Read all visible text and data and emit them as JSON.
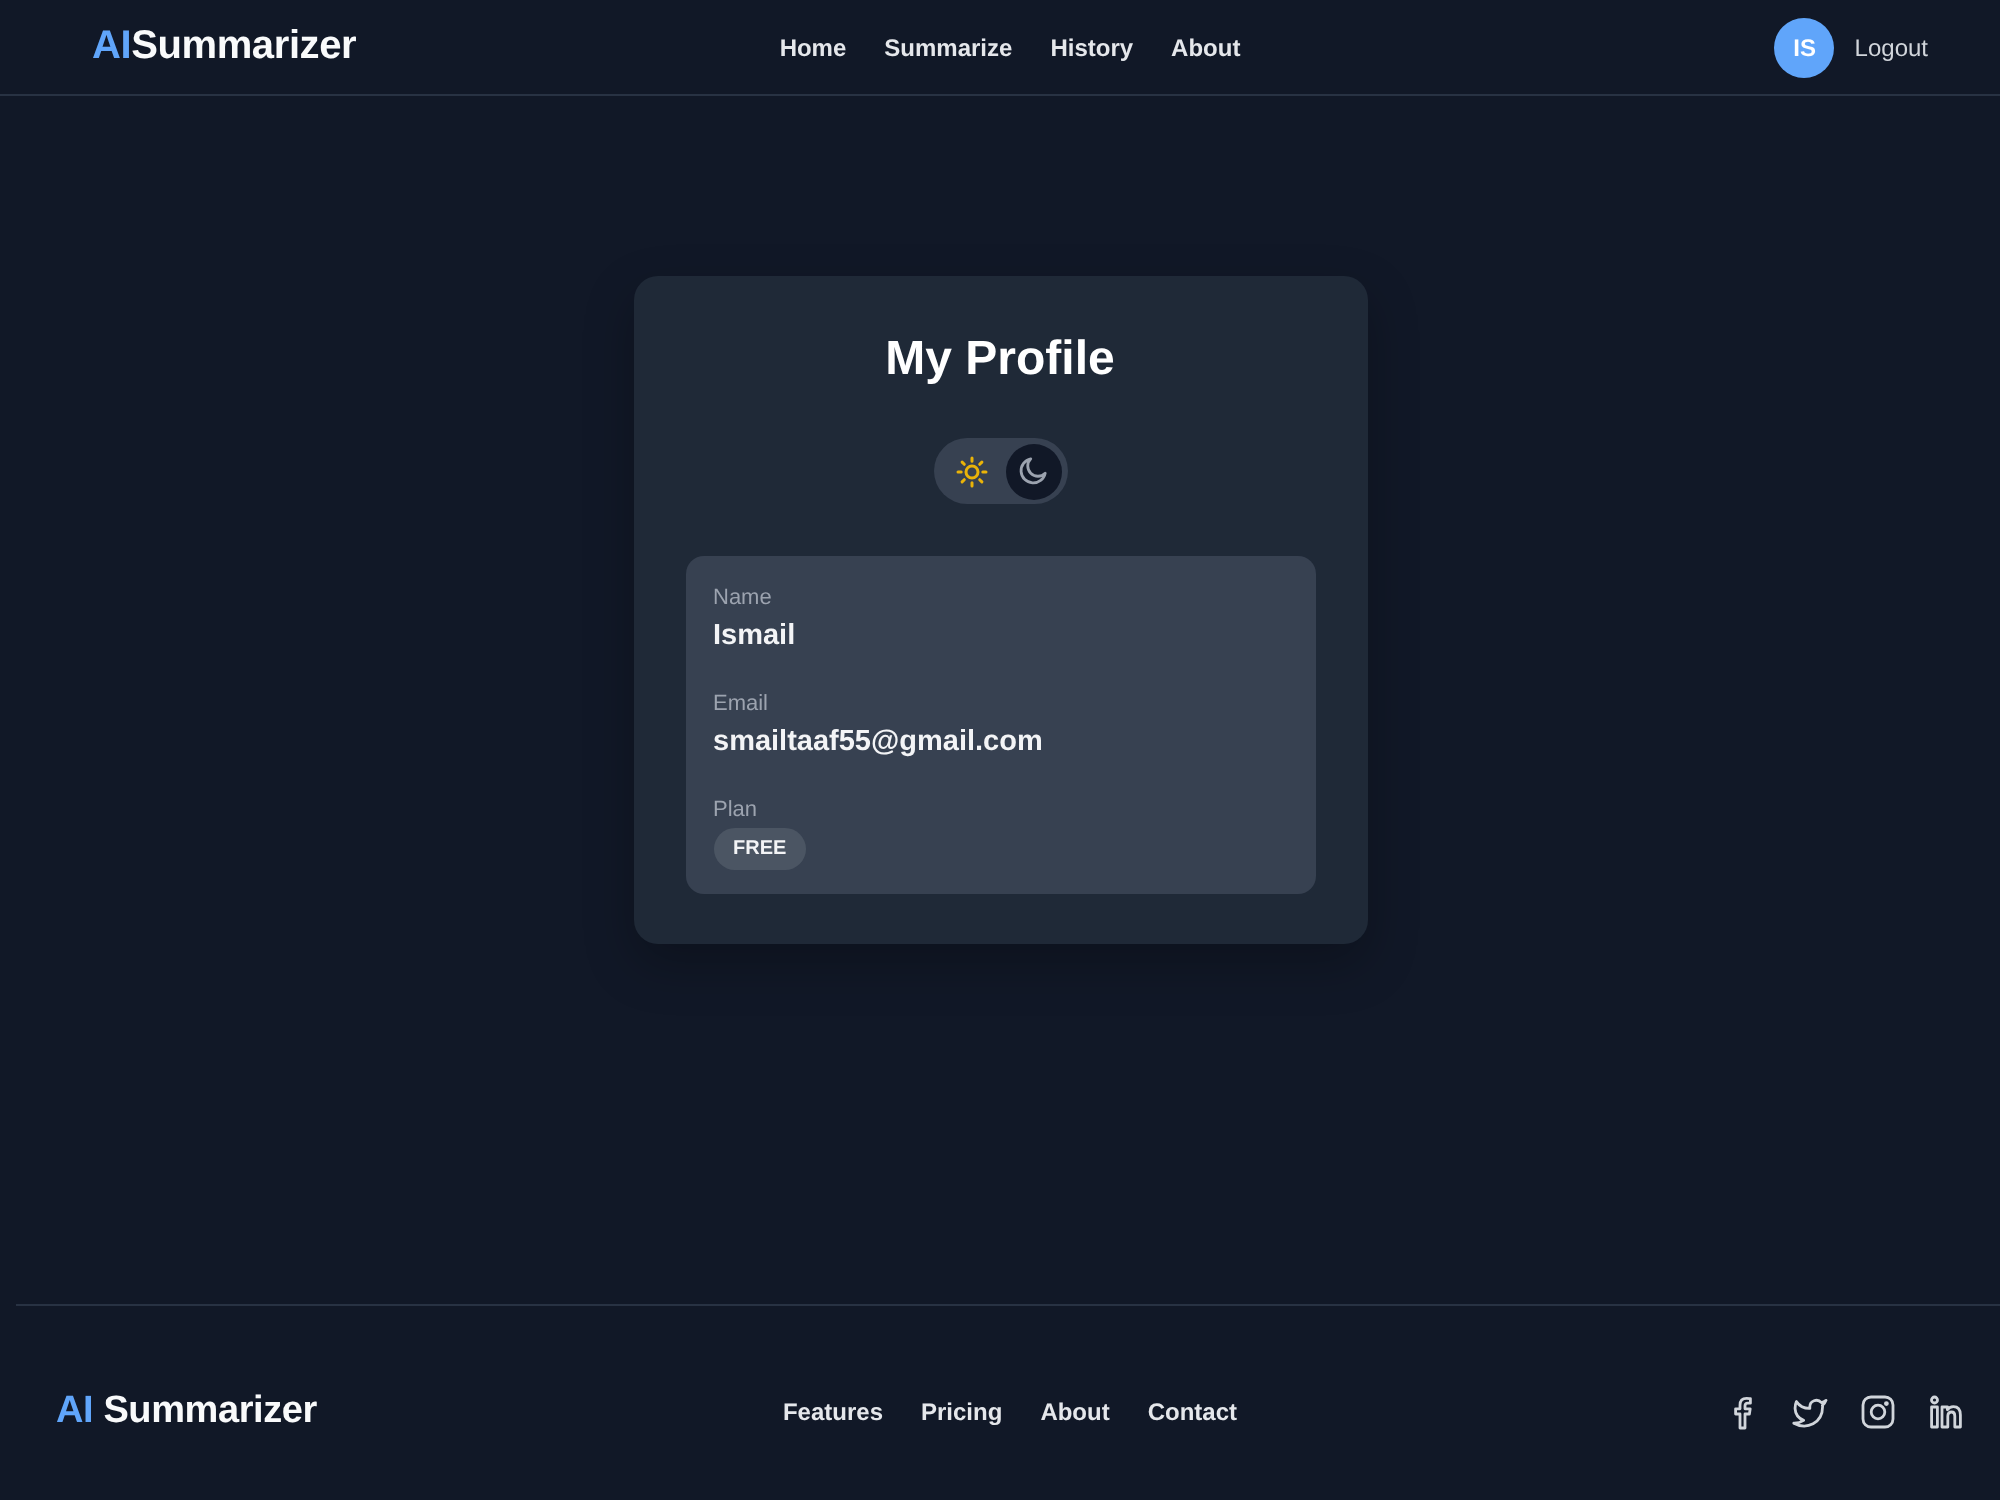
{
  "header": {
    "logo": {
      "accent": "AI",
      "text": "Summarizer"
    },
    "nav": [
      "Home",
      "Summarize",
      "History",
      "About"
    ],
    "user": {
      "initials": "IS"
    },
    "logout": "Logout"
  },
  "profile": {
    "title": "My Profile",
    "theme_toggle": [
      {
        "kind": "sun",
        "selected": false
      },
      {
        "kind": "moon",
        "selected": true
      }
    ],
    "fields": [
      {
        "kind": "text",
        "label": "Name",
        "value": "Ismail"
      },
      {
        "kind": "text",
        "label": "Email",
        "value": "smailtaaf55@gmail.com"
      },
      {
        "kind": "badge",
        "label": "Plan",
        "value": "FREE"
      }
    ]
  },
  "footer": {
    "logo": {
      "accent": "AI",
      "text": "Summarizer"
    },
    "links": [
      "Features",
      "Pricing",
      "About",
      "Contact"
    ]
  }
}
